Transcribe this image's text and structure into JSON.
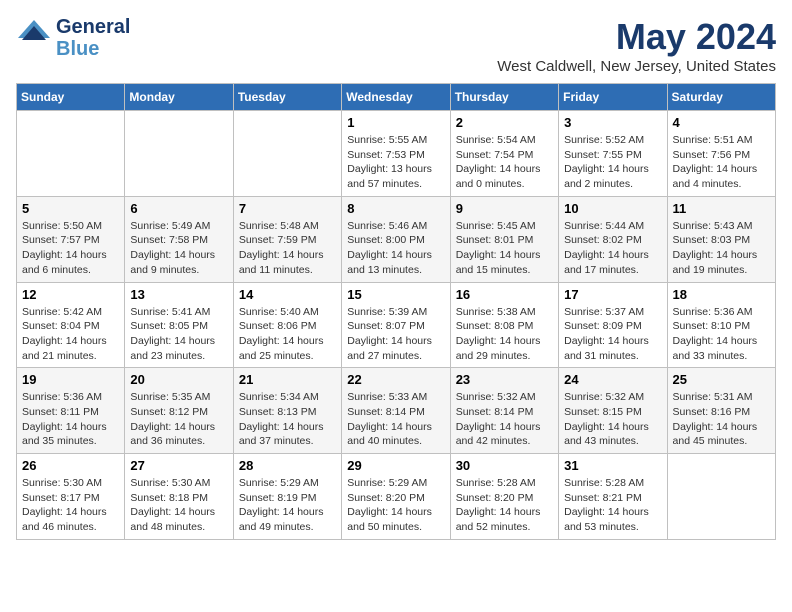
{
  "header": {
    "logo_line1": "General",
    "logo_line2": "Blue",
    "month_title": "May 2024",
    "location": "West Caldwell, New Jersey, United States"
  },
  "days_of_week": [
    "Sunday",
    "Monday",
    "Tuesday",
    "Wednesday",
    "Thursday",
    "Friday",
    "Saturday"
  ],
  "weeks": [
    [
      {
        "day": "",
        "info": ""
      },
      {
        "day": "",
        "info": ""
      },
      {
        "day": "",
        "info": ""
      },
      {
        "day": "1",
        "info": "Sunrise: 5:55 AM\nSunset: 7:53 PM\nDaylight: 13 hours\nand 57 minutes."
      },
      {
        "day": "2",
        "info": "Sunrise: 5:54 AM\nSunset: 7:54 PM\nDaylight: 14 hours\nand 0 minutes."
      },
      {
        "day": "3",
        "info": "Sunrise: 5:52 AM\nSunset: 7:55 PM\nDaylight: 14 hours\nand 2 minutes."
      },
      {
        "day": "4",
        "info": "Sunrise: 5:51 AM\nSunset: 7:56 PM\nDaylight: 14 hours\nand 4 minutes."
      }
    ],
    [
      {
        "day": "5",
        "info": "Sunrise: 5:50 AM\nSunset: 7:57 PM\nDaylight: 14 hours\nand 6 minutes."
      },
      {
        "day": "6",
        "info": "Sunrise: 5:49 AM\nSunset: 7:58 PM\nDaylight: 14 hours\nand 9 minutes."
      },
      {
        "day": "7",
        "info": "Sunrise: 5:48 AM\nSunset: 7:59 PM\nDaylight: 14 hours\nand 11 minutes."
      },
      {
        "day": "8",
        "info": "Sunrise: 5:46 AM\nSunset: 8:00 PM\nDaylight: 14 hours\nand 13 minutes."
      },
      {
        "day": "9",
        "info": "Sunrise: 5:45 AM\nSunset: 8:01 PM\nDaylight: 14 hours\nand 15 minutes."
      },
      {
        "day": "10",
        "info": "Sunrise: 5:44 AM\nSunset: 8:02 PM\nDaylight: 14 hours\nand 17 minutes."
      },
      {
        "day": "11",
        "info": "Sunrise: 5:43 AM\nSunset: 8:03 PM\nDaylight: 14 hours\nand 19 minutes."
      }
    ],
    [
      {
        "day": "12",
        "info": "Sunrise: 5:42 AM\nSunset: 8:04 PM\nDaylight: 14 hours\nand 21 minutes."
      },
      {
        "day": "13",
        "info": "Sunrise: 5:41 AM\nSunset: 8:05 PM\nDaylight: 14 hours\nand 23 minutes."
      },
      {
        "day": "14",
        "info": "Sunrise: 5:40 AM\nSunset: 8:06 PM\nDaylight: 14 hours\nand 25 minutes."
      },
      {
        "day": "15",
        "info": "Sunrise: 5:39 AM\nSunset: 8:07 PM\nDaylight: 14 hours\nand 27 minutes."
      },
      {
        "day": "16",
        "info": "Sunrise: 5:38 AM\nSunset: 8:08 PM\nDaylight: 14 hours\nand 29 minutes."
      },
      {
        "day": "17",
        "info": "Sunrise: 5:37 AM\nSunset: 8:09 PM\nDaylight: 14 hours\nand 31 minutes."
      },
      {
        "day": "18",
        "info": "Sunrise: 5:36 AM\nSunset: 8:10 PM\nDaylight: 14 hours\nand 33 minutes."
      }
    ],
    [
      {
        "day": "19",
        "info": "Sunrise: 5:36 AM\nSunset: 8:11 PM\nDaylight: 14 hours\nand 35 minutes."
      },
      {
        "day": "20",
        "info": "Sunrise: 5:35 AM\nSunset: 8:12 PM\nDaylight: 14 hours\nand 36 minutes."
      },
      {
        "day": "21",
        "info": "Sunrise: 5:34 AM\nSunset: 8:13 PM\nDaylight: 14 hours\nand 37 minutes."
      },
      {
        "day": "22",
        "info": "Sunrise: 5:33 AM\nSunset: 8:14 PM\nDaylight: 14 hours\nand 40 minutes."
      },
      {
        "day": "23",
        "info": "Sunrise: 5:32 AM\nSunset: 8:14 PM\nDaylight: 14 hours\nand 42 minutes."
      },
      {
        "day": "24",
        "info": "Sunrise: 5:32 AM\nSunset: 8:15 PM\nDaylight: 14 hours\nand 43 minutes."
      },
      {
        "day": "25",
        "info": "Sunrise: 5:31 AM\nSunset: 8:16 PM\nDaylight: 14 hours\nand 45 minutes."
      }
    ],
    [
      {
        "day": "26",
        "info": "Sunrise: 5:30 AM\nSunset: 8:17 PM\nDaylight: 14 hours\nand 46 minutes."
      },
      {
        "day": "27",
        "info": "Sunrise: 5:30 AM\nSunset: 8:18 PM\nDaylight: 14 hours\nand 48 minutes."
      },
      {
        "day": "28",
        "info": "Sunrise: 5:29 AM\nSunset: 8:19 PM\nDaylight: 14 hours\nand 49 minutes."
      },
      {
        "day": "29",
        "info": "Sunrise: 5:29 AM\nSunset: 8:20 PM\nDaylight: 14 hours\nand 50 minutes."
      },
      {
        "day": "30",
        "info": "Sunrise: 5:28 AM\nSunset: 8:20 PM\nDaylight: 14 hours\nand 52 minutes."
      },
      {
        "day": "31",
        "info": "Sunrise: 5:28 AM\nSunset: 8:21 PM\nDaylight: 14 hours\nand 53 minutes."
      },
      {
        "day": "",
        "info": ""
      }
    ]
  ]
}
